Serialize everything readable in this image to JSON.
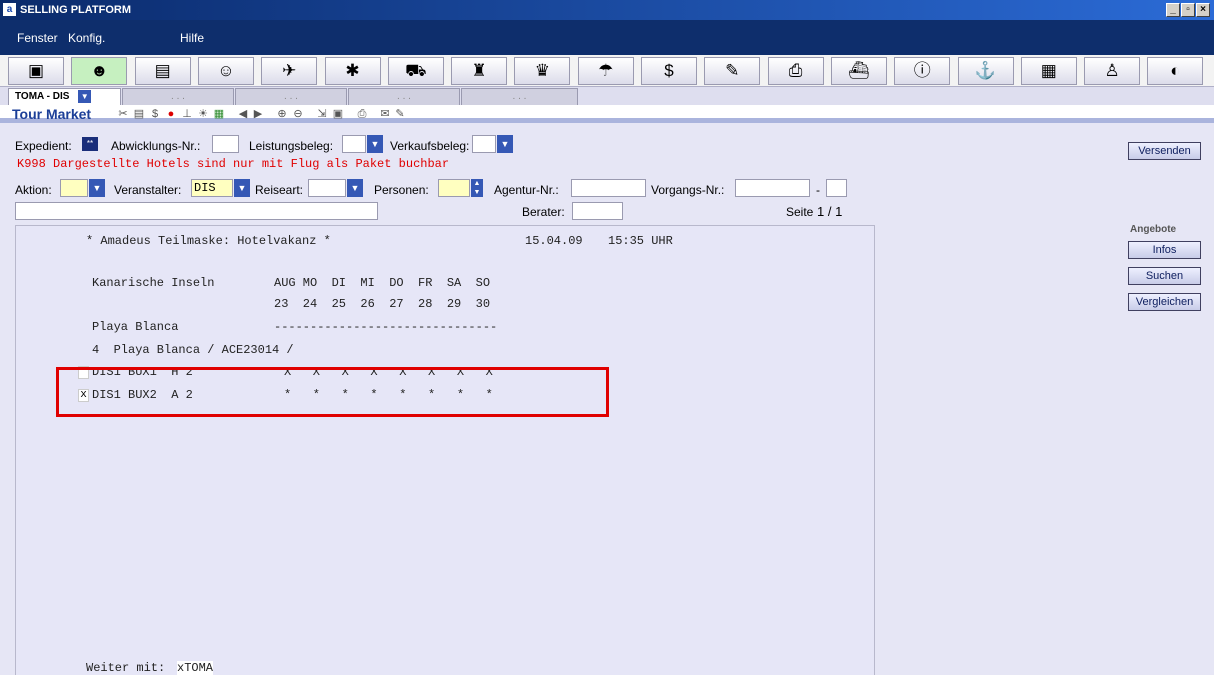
{
  "window": {
    "title": "SELLING PLATFORM"
  },
  "menu": [
    {
      "label": "Fenster"
    },
    {
      "label": "Konfig."
    },
    {
      "label": "Hilfe"
    }
  ],
  "toolbar": {
    "icons": [
      "cube-icon",
      "tour-market-icon",
      "terminal-icon",
      "agent-icon",
      "sunbed-icon",
      "bug-icon",
      "car-icon",
      "hotel-porter-icon",
      "hotel-plus-icon",
      "umbrella-icon",
      "money-icon",
      "notepad-icon",
      "printer-icon",
      "ship-icon",
      "info-icon",
      "cruise-icon",
      "document-icon",
      "captain-icon",
      "globe-icon"
    ],
    "glyphs": [
      "▣",
      "☻",
      "▤",
      "☺",
      "✈",
      "✱",
      "⛟",
      "♜",
      "♛",
      "☂",
      "$",
      "✎",
      "⎙",
      "⛴",
      "ⓘ",
      "⚓",
      "▦",
      "♙",
      "◐"
    ]
  },
  "tabs": {
    "active": "TOMA - DIS",
    "placeholders": [
      ". . .",
      ". . .",
      ". . .",
      ". . ."
    ]
  },
  "tourmarket": {
    "title": "Tour Market"
  },
  "form": {
    "expedient_label": "Expedient:",
    "expedient_badge": "**",
    "abwicklung_label": "Abwicklungs-Nr.:",
    "leistungsbeleg_label": "Leistungsbeleg:",
    "verkaufsbeleg_label": "Verkaufsbeleg:",
    "error": "K998 Dargestellte Hotels sind nur mit Flug als Paket buchbar",
    "aktion_label": "Aktion:",
    "veranstalter_label": "Veranstalter:",
    "veranstalter_value": "DIS",
    "reiseart_label": "Reiseart:",
    "personen_label": "Personen:",
    "agentur_label": "Agentur-Nr.:",
    "vorgang_label": "Vorgangs-Nr.:",
    "vorgang_sep": "-",
    "berater_label": "Berater:",
    "seite_label": "Seite",
    "seite_value": "1 / 1"
  },
  "actions": {
    "versenden": "Versenden",
    "angebote_label": "Angebote",
    "infos": "Infos",
    "suchen": "Suchen",
    "vergleichen": "Vergleichen"
  },
  "screen": {
    "header": "* Amadeus Teilmaske: Hotelvakanz *",
    "date": "15.04.09",
    "time": "15:35 UHR",
    "region": "Kanarische Inseln",
    "days_header": "AUG MO  DI  MI  DO  FR  SA  SO",
    "days_dates": "23  24  25  26  27  28  29  30",
    "location": "Playa Blanca",
    "divider": "-------------------------------",
    "hotel": "4  Playa Blanca / ACE23014 /",
    "row1_code": "DIS1 BUX1  H 2",
    "row1_avail": "X   X   X   X   X   X   X   X",
    "row2_check": "x",
    "row2_code": "DIS1 BUX2  A 2",
    "row2_avail": "*   *   *   *   *   *   *   *",
    "weiter_label": "Weiter mit:",
    "weiter_value": "xTOMA"
  }
}
